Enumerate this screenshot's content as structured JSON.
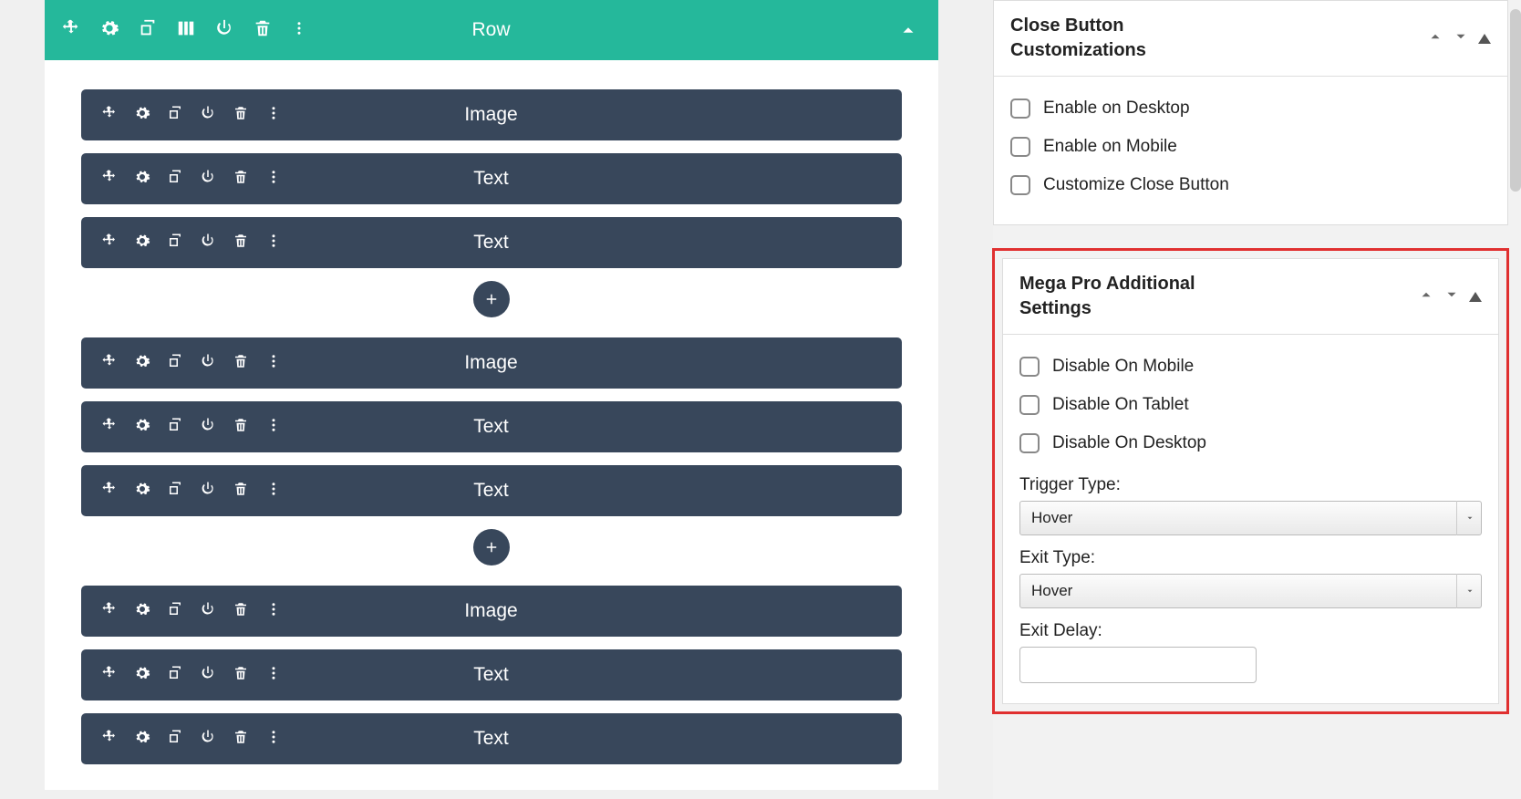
{
  "row": {
    "title": "Row"
  },
  "groups": [
    {
      "blocks": [
        "Image",
        "Text",
        "Text"
      ]
    },
    {
      "blocks": [
        "Image",
        "Text",
        "Text"
      ]
    },
    {
      "blocks": [
        "Image",
        "Text",
        "Text"
      ]
    }
  ],
  "panels": {
    "close_button": {
      "title": "Close Button Customizations",
      "options": [
        "Enable on Desktop",
        "Enable on Mobile",
        "Customize Close Button"
      ]
    },
    "mega_pro": {
      "title": "Mega Pro Additional Settings",
      "options": [
        "Disable On Mobile",
        "Disable On Tablet",
        "Disable On Desktop"
      ],
      "trigger_label": "Trigger Type:",
      "trigger_value": "Hover",
      "exit_label": "Exit Type:",
      "exit_value": "Hover",
      "exit_delay_label": "Exit Delay:",
      "exit_delay_value": ""
    }
  }
}
